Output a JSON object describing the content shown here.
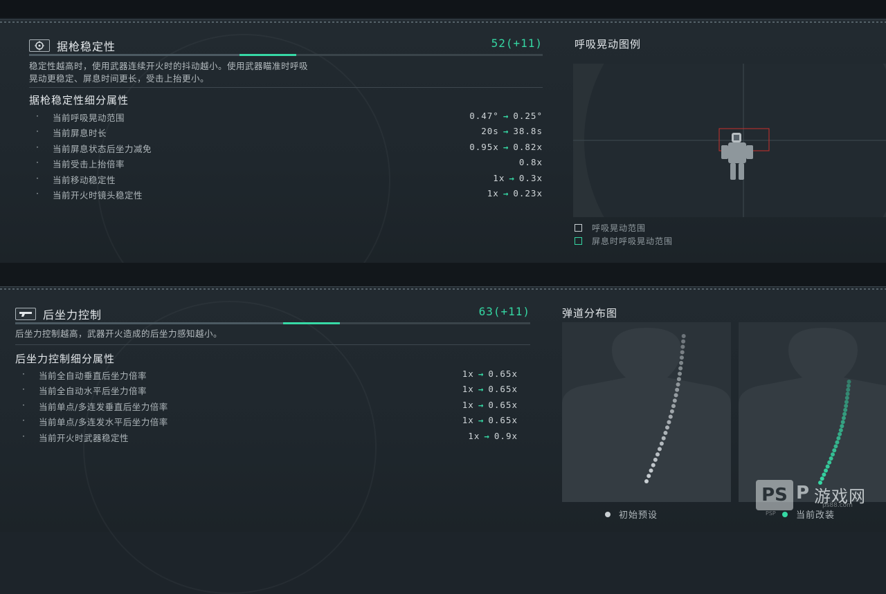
{
  "stability": {
    "title": "据枪稳定性",
    "score": "52(+11)",
    "base_fraction": 0.52,
    "bonus_fraction": 0.11,
    "description_line1": "稳定性越高时，使用武器连续开火时的抖动越小。使用武器瞄准时呼吸",
    "description_line2": "晃动更稳定、屏息时间更长，受击上抬更小。",
    "sub_title": "据枪稳定性细分属性",
    "attributes": [
      {
        "bullet": "·",
        "name": "当前呼吸晃动范围",
        "from": "0.47°",
        "arrow": "→",
        "to": "0.25°"
      },
      {
        "bullet": "·",
        "name": "当前屏息时长",
        "from": "20s",
        "arrow": "→",
        "to": "38.8s"
      },
      {
        "bullet": "·",
        "name": "当前屏息状态后坐力减免",
        "from": "0.95x",
        "arrow": "→",
        "to": "0.82x"
      },
      {
        "bullet": "·",
        "name": "当前受击上抬倍率",
        "from": "",
        "arrow": "",
        "to": "0.8x"
      },
      {
        "bullet": "·",
        "name": "当前移动稳定性",
        "from": "1x",
        "arrow": "→",
        "to": "0.3x"
      },
      {
        "bullet": "·",
        "name": "当前开火时镜头稳定性",
        "from": "1x",
        "arrow": "→",
        "to": "0.23x"
      }
    ],
    "side_title": "呼吸晃动图例",
    "legend": [
      {
        "label": "呼吸晃动范围",
        "color": "#c9cfd3"
      },
      {
        "label": "屏息时呼吸晃动范围",
        "color": "#35d7a3"
      }
    ]
  },
  "recoil": {
    "title": "后坐力控制",
    "score": "63(+11)",
    "base_fraction": 0.63,
    "bonus_fraction": 0.11,
    "description": "后坐力控制越高，武器开火造成的后坐力感知越小。",
    "sub_title": "后坐力控制细分属性",
    "attributes": [
      {
        "bullet": "·",
        "name": "当前全自动垂直后坐力倍率",
        "from": "1x",
        "arrow": "→",
        "to": "0.65x"
      },
      {
        "bullet": "·",
        "name": "当前全自动水平后坐力倍率",
        "from": "1x",
        "arrow": "→",
        "to": "0.65x"
      },
      {
        "bullet": "·",
        "name": "当前单点/多连发垂直后坐力倍率",
        "from": "1x",
        "arrow": "→",
        "to": "0.65x"
      },
      {
        "bullet": "·",
        "name": "当前单点/多连发水平后坐力倍率",
        "from": "1x",
        "arrow": "→",
        "to": "0.65x"
      },
      {
        "bullet": "·",
        "name": "当前开火时武器稳定性",
        "from": "1x",
        "arrow": "→",
        "to": "0.9x"
      }
    ],
    "side_title": "弹道分布图",
    "legend": [
      {
        "label": "初始预设",
        "color": "#c9cfd3"
      },
      {
        "label": "当前改装",
        "color": "#35d7a3"
      }
    ]
  },
  "watermark": {
    "logo": "PS",
    "p": "P",
    "site": "游戏网",
    "domain": "ps88.com",
    "mini": "PSP"
  },
  "colors": {
    "accent": "#35d7a3",
    "background": "#1d242a"
  }
}
